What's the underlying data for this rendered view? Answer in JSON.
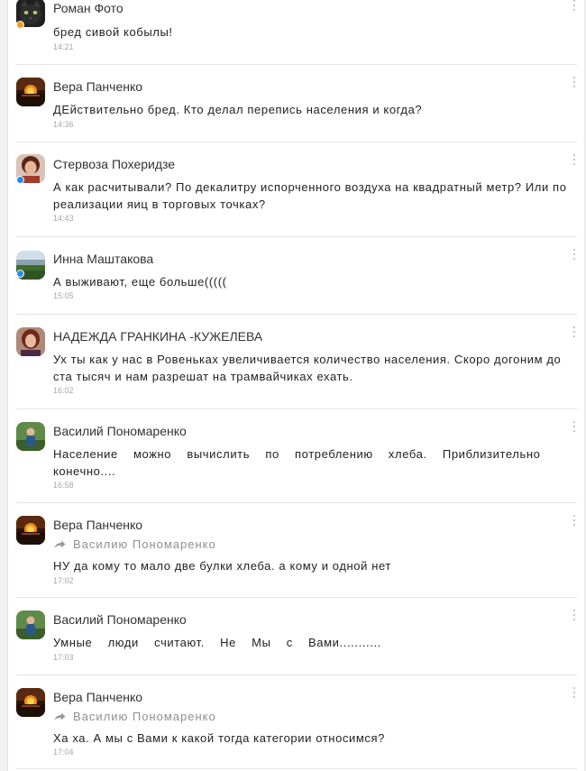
{
  "comments": [
    {
      "author": "Роман Фото",
      "text": "бред сивой кобылы!",
      "time": "14:21",
      "avatar_icon": "cat-photo-avatar",
      "online_color": "#f39a1e"
    },
    {
      "author": "Вера Панченко",
      "text": "ДЕйствительно бред. Кто делал перепись населения и когда?",
      "time": "14:36",
      "avatar_icon": "sunset-photo-avatar"
    },
    {
      "author": "Стервоза Похеридзе",
      "text": "А как расчитывали? По декалитру испорченного воздуха на квадратный метр? Или по реализации яиц в торговых точках?",
      "time": "14:43",
      "avatar_icon": "woman-photo-avatar",
      "online_color": "#2a8ae6"
    },
    {
      "author": "Инна Маштакова",
      "text": "А выживают, еще больше(((((",
      "time": "15:05",
      "avatar_icon": "landscape-photo-avatar",
      "online_color": "#2a8ae6"
    },
    {
      "author": "НАДЕЖДА ГРАНКИНА -КУЖЕЛЕВА",
      "text": "Ух ты как у нас в Ровеньках увеличивается количество населения. Скоро догоним до ста тысяч и  нам разрешат на  трамвайчиках ехать.",
      "time": "16:02",
      "avatar_icon": "woman-portrait-avatar"
    },
    {
      "author": "Василий Пономаренко",
      "text": "Население можно вычислить по потреблению хлеба. Приблизительно конечно....",
      "time": "16:58",
      "avatar_icon": "person-outdoor-avatar"
    },
    {
      "author": "Вера Панченко",
      "reply_to": "Василию Пономаренко",
      "text": "НУ да кому то мало две булки хлеба. а кому и одной нет",
      "time": "17:02",
      "avatar_icon": "sunset-photo-avatar"
    },
    {
      "author": "Василий Пономаренко",
      "text": "Умные люди считают. Не Мы с Вами...........",
      "time": "17:03",
      "avatar_icon": "person-outdoor-avatar"
    },
    {
      "author": "Вера Панченко",
      "reply_to": "Василию Пономаренко",
      "text": "Ха ха. А мы с Вами к какой тогда категории относимся?",
      "time": "17:04",
      "avatar_icon": "sunset-photo-avatar"
    }
  ]
}
